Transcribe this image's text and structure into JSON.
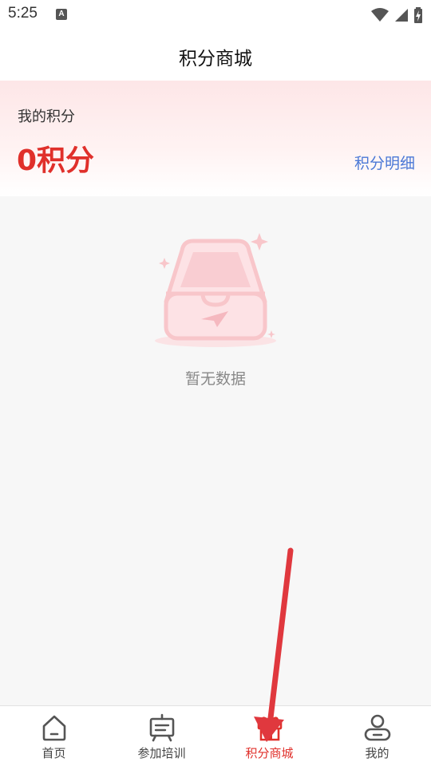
{
  "status_bar": {
    "time": "5:25",
    "notification_icon": "A",
    "icons": [
      "wifi-icon",
      "cell-signal-icon",
      "battery-icon"
    ]
  },
  "header": {
    "title": "积分商城"
  },
  "points": {
    "label": "我的积分",
    "value": "0积分",
    "detail_link": "积分明细"
  },
  "empty_state": {
    "illustration": "empty-inbox-icon",
    "text": "暂无数据"
  },
  "tab_bar": {
    "items": [
      {
        "label": "首页",
        "icon": "home-icon",
        "active": false
      },
      {
        "label": "参加培训",
        "icon": "training-board-icon",
        "active": false
      },
      {
        "label": "积分商城",
        "icon": "gift-icon",
        "active": true
      },
      {
        "label": "我的",
        "icon": "profile-icon",
        "active": false
      }
    ]
  },
  "colors": {
    "accent": "#e0302b",
    "link": "#4a78d6",
    "empty_illustration": "#f8c6ca",
    "annotation_arrow": "#e0383e"
  }
}
